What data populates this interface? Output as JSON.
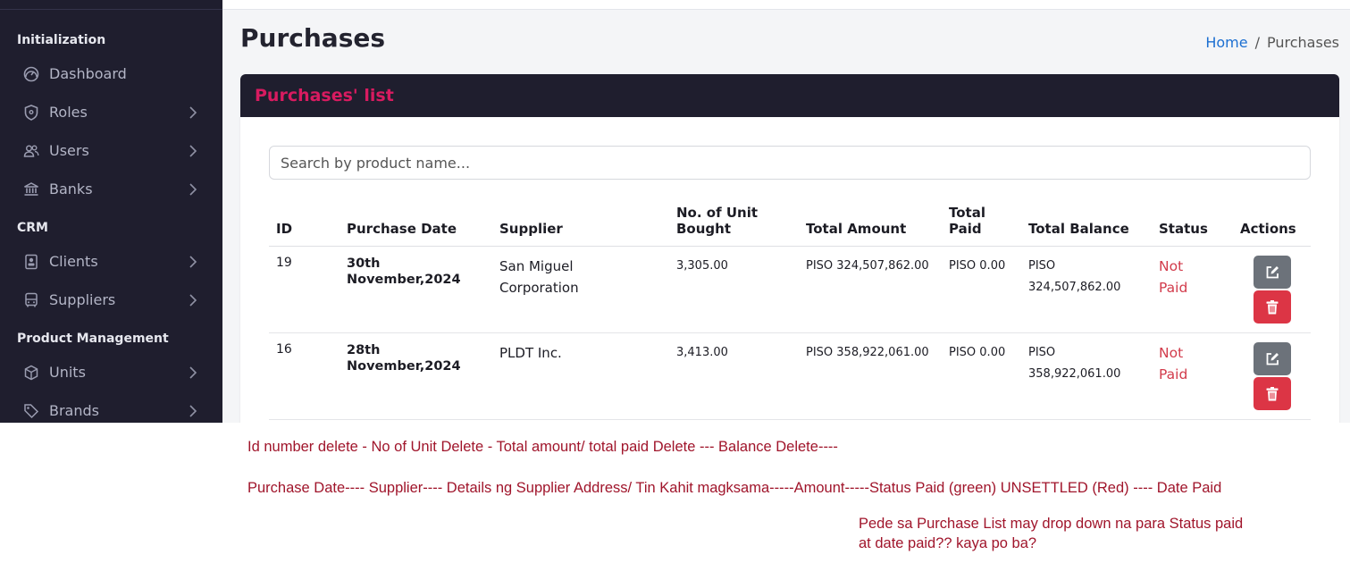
{
  "sidebar": {
    "sections": [
      {
        "title": "Initialization"
      },
      {
        "title": "CRM"
      },
      {
        "title": "Product Management"
      }
    ],
    "items": [
      {
        "label": "Dashboard",
        "icon": "dashboard-icon"
      },
      {
        "label": "Roles",
        "icon": "shield-icon"
      },
      {
        "label": "Users",
        "icon": "users-icon"
      },
      {
        "label": "Banks",
        "icon": "bank-icon"
      },
      {
        "label": "Clients",
        "icon": "id-card-icon"
      },
      {
        "label": "Suppliers",
        "icon": "bus-icon"
      },
      {
        "label": "Units",
        "icon": "cube-icon"
      },
      {
        "label": "Brands",
        "icon": "tag-icon"
      }
    ]
  },
  "header": {
    "title": "Purchases",
    "breadcrumb": {
      "home": "Home",
      "separator": "/",
      "current": "Purchases"
    }
  },
  "card": {
    "title": "Purchases' list",
    "search_placeholder": "Search by product name..."
  },
  "table": {
    "columns": {
      "id": "ID",
      "purchase_date": "Purchase Date",
      "supplier": "Supplier",
      "units_line1": "No. of Unit",
      "units_line2": "Bought",
      "total_amount": "Total Amount",
      "paid_line1": "Total",
      "paid_line2": "Paid",
      "total_balance": "Total Balance",
      "status": "Status",
      "actions": "Actions"
    },
    "rows": [
      {
        "id": "19",
        "date_line1": "30th",
        "date_line2": "November,2024",
        "supplier_line1": "San Miguel",
        "supplier_line2": "Corporation",
        "units": "3,305.00",
        "total_amount": "PISO 324,507,862.00",
        "total_paid": "PISO 0.00",
        "balance_line1": "PISO",
        "balance_line2": "324,507,862.00",
        "status_line1": "Not",
        "status_line2": "Paid"
      },
      {
        "id": "16",
        "date_line1": "28th",
        "date_line2": "November,2024",
        "supplier_line1": "PLDT Inc.",
        "supplier_line2": "",
        "units": "3,413.00",
        "total_amount": "PISO 358,922,061.00",
        "total_paid": "PISO 0.00",
        "balance_line1": "PISO",
        "balance_line2": "358,922,061.00",
        "status_line1": "Not",
        "status_line2": "Paid"
      }
    ]
  },
  "annotations": {
    "line1": "Id number delete - No of Unit Delete - Total amount/ total paid Delete --- Balance Delete----",
    "line2": "Purchase Date---- Supplier---- Details ng Supplier Address/ Tin Kahit magksama-----Amount-----Status Paid (green) UNSETTLED (Red) ---- Date Paid",
    "line3": "Pede sa Purchase List may drop down na para Status paid",
    "line4": "at date paid?? kaya po ba?"
  },
  "colors": {
    "sidebar_bg": "#1f1e2e",
    "accent": "#d81b60",
    "link": "#1c6fd1",
    "status_unpaid": "#d23b4b",
    "edit_button": "#6c727a",
    "delete_button": "#dc3545",
    "annotation_text": "#a0152b"
  }
}
